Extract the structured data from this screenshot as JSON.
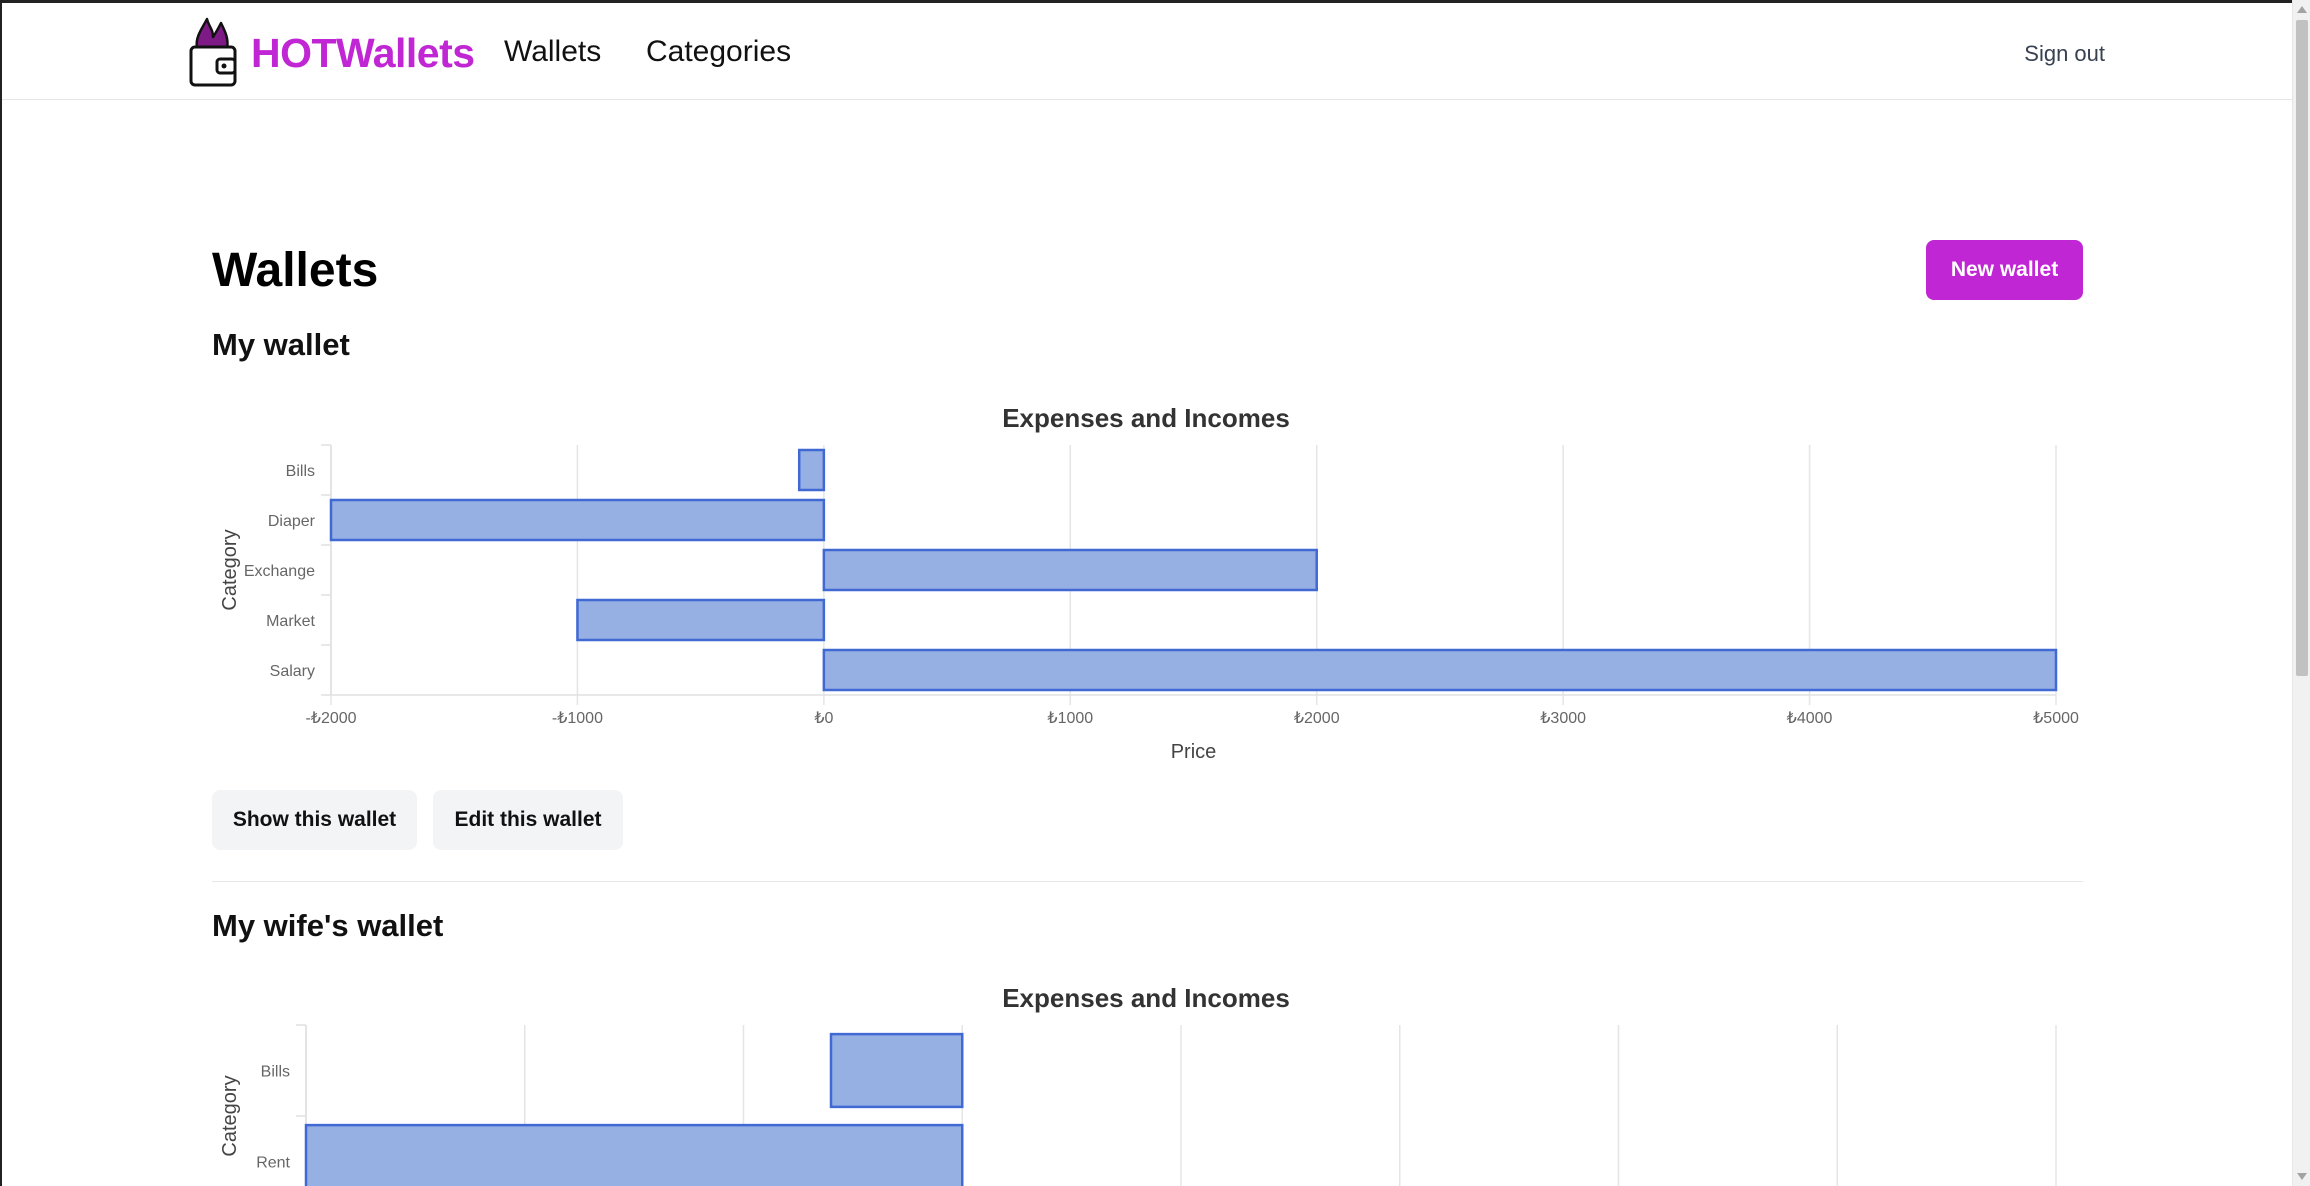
{
  "app": {
    "brand": "HOTWallets",
    "nav": {
      "wallets": "Wallets",
      "categories": "Categories",
      "sign_out": "Sign out"
    }
  },
  "page": {
    "title": "Wallets",
    "new_wallet_button": "New wallet"
  },
  "wallets": [
    {
      "name": "My wallet",
      "show_button": "Show this wallet",
      "edit_button": "Edit this wallet"
    },
    {
      "name": "My wife's wallet"
    }
  ],
  "colors": {
    "brand": "#c026d3",
    "bar_fill": "#97b0e3",
    "bar_stroke": "#4169d4"
  },
  "chart_data": [
    {
      "type": "bar",
      "orientation": "horizontal",
      "title": "Expenses and Incomes",
      "xlabel": "Price",
      "ylabel": "Category",
      "categories": [
        "Bills",
        "Diaper",
        "Exchange",
        "Market",
        "Salary"
      ],
      "values": [
        -100,
        -2000,
        2000,
        -1000,
        5000
      ],
      "xlim": [
        -2000,
        5000
      ],
      "xticks": [
        "-₺2000",
        "-₺1000",
        "₺0",
        "₺1000",
        "₺2000",
        "₺3000",
        "₺4000",
        "₺5000"
      ],
      "grid": true
    },
    {
      "type": "bar",
      "orientation": "horizontal",
      "title": "Expenses and Incomes",
      "ylabel": "Category",
      "categories": [
        "Bills",
        "Rent"
      ],
      "values": [
        -600,
        -3000
      ],
      "xlim": [
        -3000,
        5000
      ],
      "grid": true
    }
  ]
}
